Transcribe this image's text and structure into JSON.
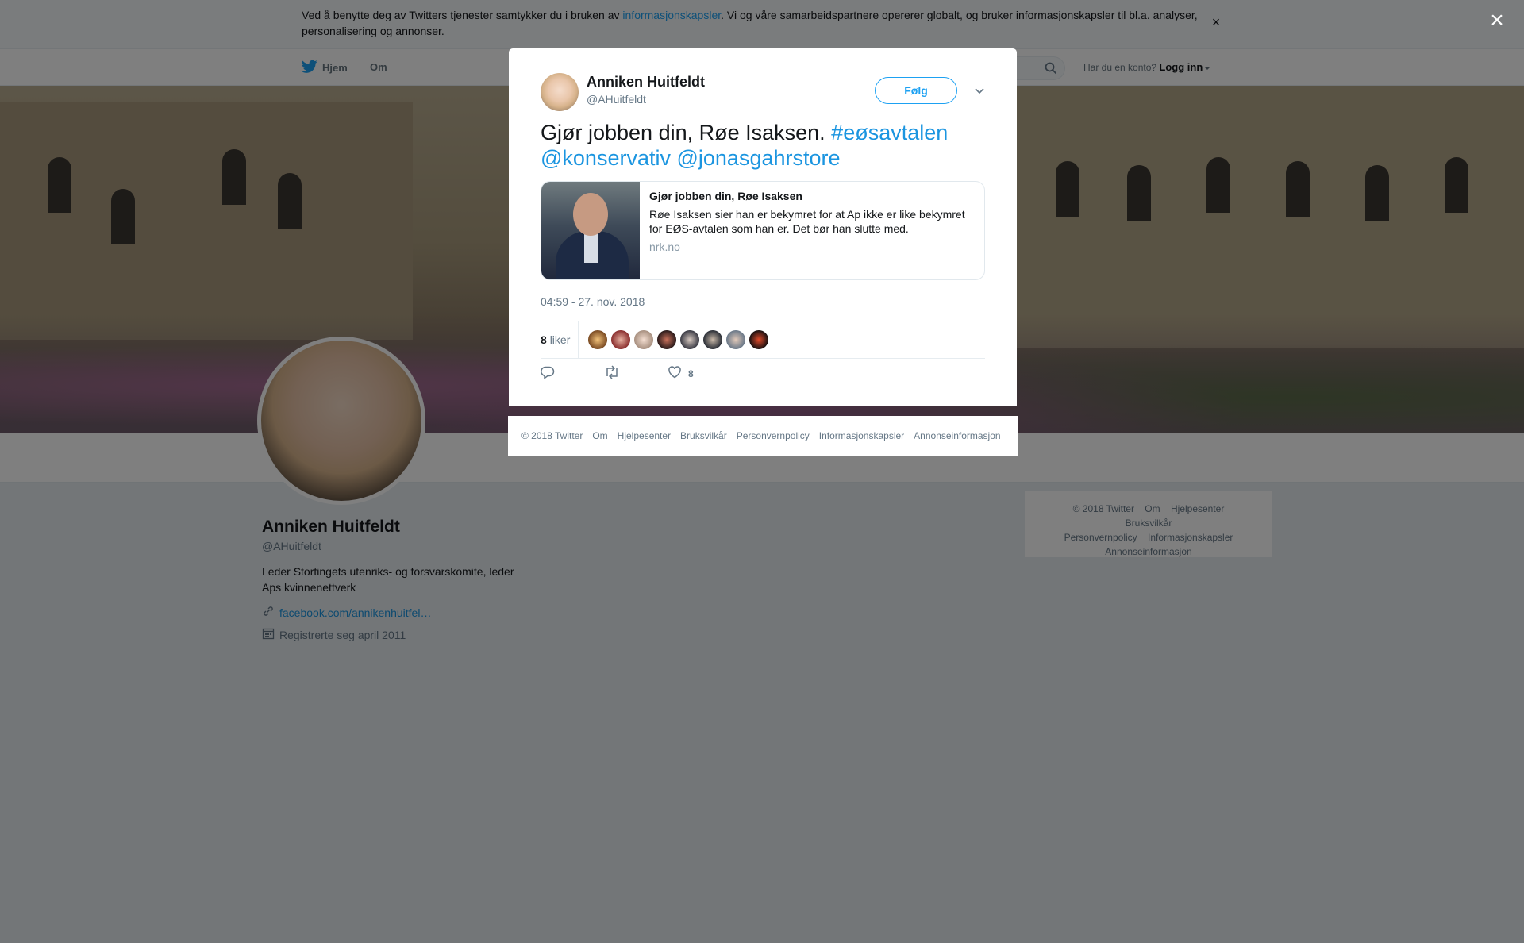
{
  "cookie_bar": {
    "text_before": "Ved å benytte deg av Twitters tjenester samtykker du i bruken av ",
    "link": "informasjonskapsler",
    "text_after": ". Vi og våre samarbeidspartnere opererer globalt, og bruker informasjonskapsler til bl.a. analyser, personalisering og annonser.",
    "close": "×"
  },
  "nav": {
    "home": "Hjem",
    "about": "Om",
    "account_prompt": "Har du en konto?",
    "login": "Logg inn"
  },
  "profile": {
    "name": "Anniken Huitfeldt",
    "handle": "@AHuitfeldt",
    "bio": "Leder Stortingets utenriks- og forsvarskomite, leder Aps kvinnenettverk",
    "link": "facebook.com/annikenhuitfel…",
    "joined": "Registrerte seg april 2011"
  },
  "side_footer": [
    "© 2018 Twitter",
    "Om",
    "Hjelpesenter",
    "Bruksvilkår",
    "Personvernpolicy",
    "Informasjonskapsler",
    "Annonseinformasjon"
  ],
  "overlay": {
    "close": "×"
  },
  "tweet": {
    "author_name": "Anniken Huitfeldt",
    "author_handle": "@AHuitfeldt",
    "follow_label": "Følg",
    "text": "Gjør jobben din, Røe Isaksen. ",
    "hashtag": "#eøsavtalen",
    "mention1": "@konservativ",
    "mention2": "@jonasgahrstore",
    "card": {
      "title": "Gjør jobben din, Røe Isaksen",
      "description": "Røe Isaksen sier han er bekymret for at Ap ikke er like bekymret for EØS-avtalen som han er. Det bør han slutte med.",
      "domain": "nrk.no"
    },
    "timestamp": "04:59 - 27. nov. 2018",
    "likes_count": "8",
    "likes_label": "liker",
    "like_action_count": "8"
  },
  "modal_footer": [
    "© 2018 Twitter",
    "Om",
    "Hjelpesenter",
    "Bruksvilkår",
    "Personvernpolicy",
    "Informasjonskapsler",
    "Annonseinformasjon"
  ],
  "colors": {
    "accent": "#1da1f2",
    "link": "#1b95e0",
    "secondary_text": "#657786"
  },
  "icons": {
    "nav_logo": "twitter-bird-icon",
    "search": "search-icon",
    "menu": "chevron-down-icon",
    "reply": "reply-icon",
    "retweet": "retweet-icon",
    "like": "heart-icon",
    "link": "link-icon",
    "calendar": "calendar-icon"
  }
}
